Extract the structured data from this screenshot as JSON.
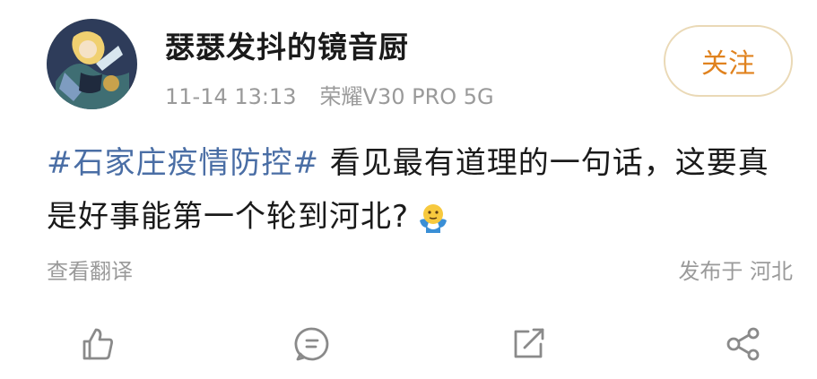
{
  "user": {
    "name": "瑟瑟发抖的镜音厨",
    "timestamp": "11-14 13:13",
    "device": "荣耀V30 PRO 5G"
  },
  "follow_label": "关注",
  "post": {
    "hashtag": "#石家庄疫情防控#",
    "text": " 看见最有道理的一句话，这要真是好事能第一个轮到河北?"
  },
  "translate_label": "查看翻译",
  "location_label": "发布于 河北",
  "actions": [
    "like-icon",
    "comment-icon",
    "repost-icon",
    "share-icon"
  ],
  "colors": {
    "accent": "#e0821e",
    "hashtag": "#4a6ea5",
    "muted": "#9a9a9a"
  }
}
